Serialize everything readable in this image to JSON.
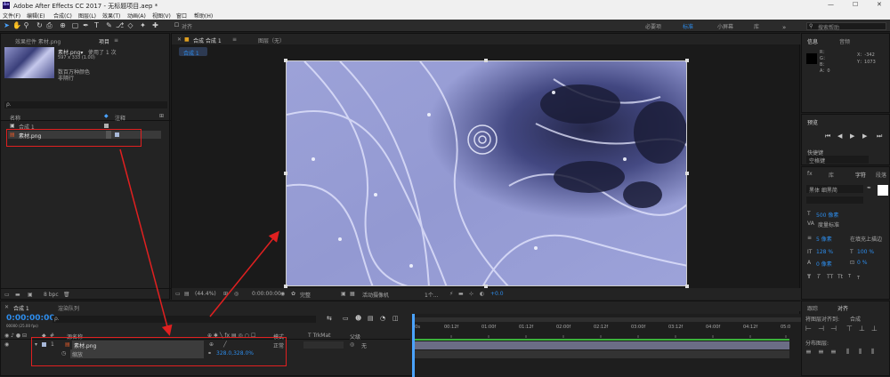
{
  "titlebar": {
    "app_badge": "Ae",
    "title": "Adobe After Effects CC 2017 - 无标题项目.aep *",
    "min": "—",
    "max": "☐",
    "close": "✕"
  },
  "menu": [
    "文件(F)",
    "编辑(E)",
    "合成(C)",
    "图层(L)",
    "效果(T)",
    "动画(A)",
    "视图(V)",
    "窗口",
    "帮助(H)"
  ],
  "toolbar": {
    "align_label": "对齐",
    "workspaces": [
      "必要项",
      "标准",
      "小屏幕",
      "库"
    ],
    "search_placeholder": "搜索帮助"
  },
  "project": {
    "tab_effects": "效果控件 素材.png",
    "tab_project": "项目",
    "tab_menu": "≡",
    "asset_name": "素材.png▾",
    "asset_usage": "使用了 1 次",
    "asset_dims": "597 x 333 (1.00)",
    "asset_color": "数百万种颜色",
    "asset_interlace": "非隔行",
    "search_glyph": "ρ.",
    "col_name": "名称",
    "col_comment": "注释",
    "items": [
      {
        "name": "合成 1",
        "type": "comp"
      },
      {
        "name": "素材.png",
        "type": "footage"
      }
    ],
    "bpc": "8 bpc"
  },
  "comp": {
    "tab": "合成 合成 1",
    "tab_menu": "≡",
    "layer_tab": "图层（无）",
    "breadcrumb": "合成 1",
    "zoom": "(44.4%)",
    "time": "0:00:00:00",
    "resolution": "完整",
    "camera": "活动摄像机",
    "views": "1个...",
    "exposure": "+0.0"
  },
  "info": {
    "tab_info": "信息",
    "tab_audio": "音频",
    "r": "R：",
    "g": "G：",
    "b": "B：",
    "a": "A：0",
    "x": "X：-342",
    "y": "Y：1073"
  },
  "preview": {
    "tab": "预览",
    "shortcut_label": "快捷键",
    "shortcut_value": "空格键"
  },
  "effects": {
    "tab_fx": "fx",
    "tab_lib": "库",
    "tab_char": "字符",
    "tab_para": "段落",
    "font": "黑体 细黑简",
    "size": "500 像素",
    "tracking_label": "度量标准",
    "stroke": "5 像素",
    "stroke_fill": "在填充上描边",
    "scale_v": "128 %",
    "scale_h": "100 %",
    "baseline": "0 像素",
    "tsume": "0 %",
    "styles": [
      "T",
      "T",
      "TT",
      "Tt",
      "T",
      "T",
      "T",
      "T"
    ]
  },
  "align": {
    "tab_tracker": "跟踪",
    "tab_align": "对齐",
    "align_to_label": "将图层对齐到:",
    "align_to_value": "合成",
    "distribute_label": "分布图层:"
  },
  "timeline": {
    "tab_comp": "合成 1",
    "tab_render": "渲染队列",
    "timecode": "0:00:00:00",
    "fps": "00000 (25.00 fps)",
    "search_glyph": "ρ.",
    "col_layer_name": "源名称",
    "col_mode": "模式",
    "col_trkmat": "T TrkMat",
    "col_parent": "父级",
    "layer": {
      "num": "1",
      "name": "素材.png",
      "mode": "正常",
      "parent": "无"
    },
    "prop": {
      "name": "缩放",
      "value": "328.0,328.0%"
    },
    "ruler": [
      "00s",
      "00:12f",
      "01:00f",
      "01:12f",
      "02:00f",
      "02:12f",
      "03:00f",
      "03:12f",
      "04:00f",
      "04:12f",
      "05:0"
    ]
  },
  "colors": {
    "accent": "#2d8ceb",
    "annotation": "#e02020",
    "work_area": "#3bb33b"
  }
}
